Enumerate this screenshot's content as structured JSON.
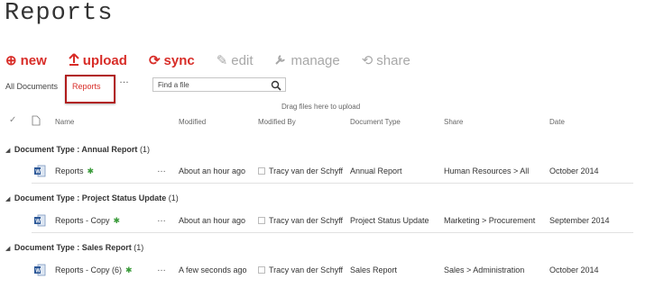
{
  "page_title": "Reports",
  "toolbar": {
    "new_label": "new",
    "upload_label": "upload",
    "sync_label": "sync",
    "edit_label": "edit",
    "manage_label": "manage",
    "share_label": "share"
  },
  "views": {
    "all_label": "All Documents",
    "reports_label": "Reports",
    "more_label": "…"
  },
  "search": {
    "placeholder": "Find a file"
  },
  "drag_hint": "Drag files here to upload",
  "columns": {
    "name": "Name",
    "modified": "Modified",
    "modified_by": "Modified By",
    "document_type": "Document Type",
    "share": "Share",
    "date": "Date"
  },
  "groups": [
    {
      "label": "Document Type : Annual Report",
      "count": "(1)",
      "item": {
        "name": "Reports",
        "badge": "✱",
        "dots": "…",
        "modified": "About an hour ago",
        "modified_by": "Tracy van der Schyff",
        "document_type": "Annual Report",
        "share": "Human Resources > All",
        "date": "October 2014"
      }
    },
    {
      "label": "Document Type : Project Status Update",
      "count": "(1)",
      "item": {
        "name": "Reports - Copy",
        "badge": "✱",
        "dots": "…",
        "modified": "About an hour ago",
        "modified_by": "Tracy van der Schyff",
        "document_type": "Project Status Update",
        "share": "Marketing > Procurement",
        "date": "September 2014"
      }
    },
    {
      "label": "Document Type : Sales Report",
      "count": "(1)",
      "item": {
        "name": "Reports - Copy (6)",
        "badge": "✱",
        "dots": "…",
        "modified": "A few seconds ago",
        "modified_by": "Tracy van der Schyff",
        "document_type": "Sales Report",
        "share": "Sales > Administration",
        "date": "October 2014"
      }
    }
  ],
  "colors": {
    "accent": "#d82d28",
    "highlight_box": "#b11c1c",
    "badge": "#3a9b3a",
    "disabled": "#a8a8a8"
  }
}
